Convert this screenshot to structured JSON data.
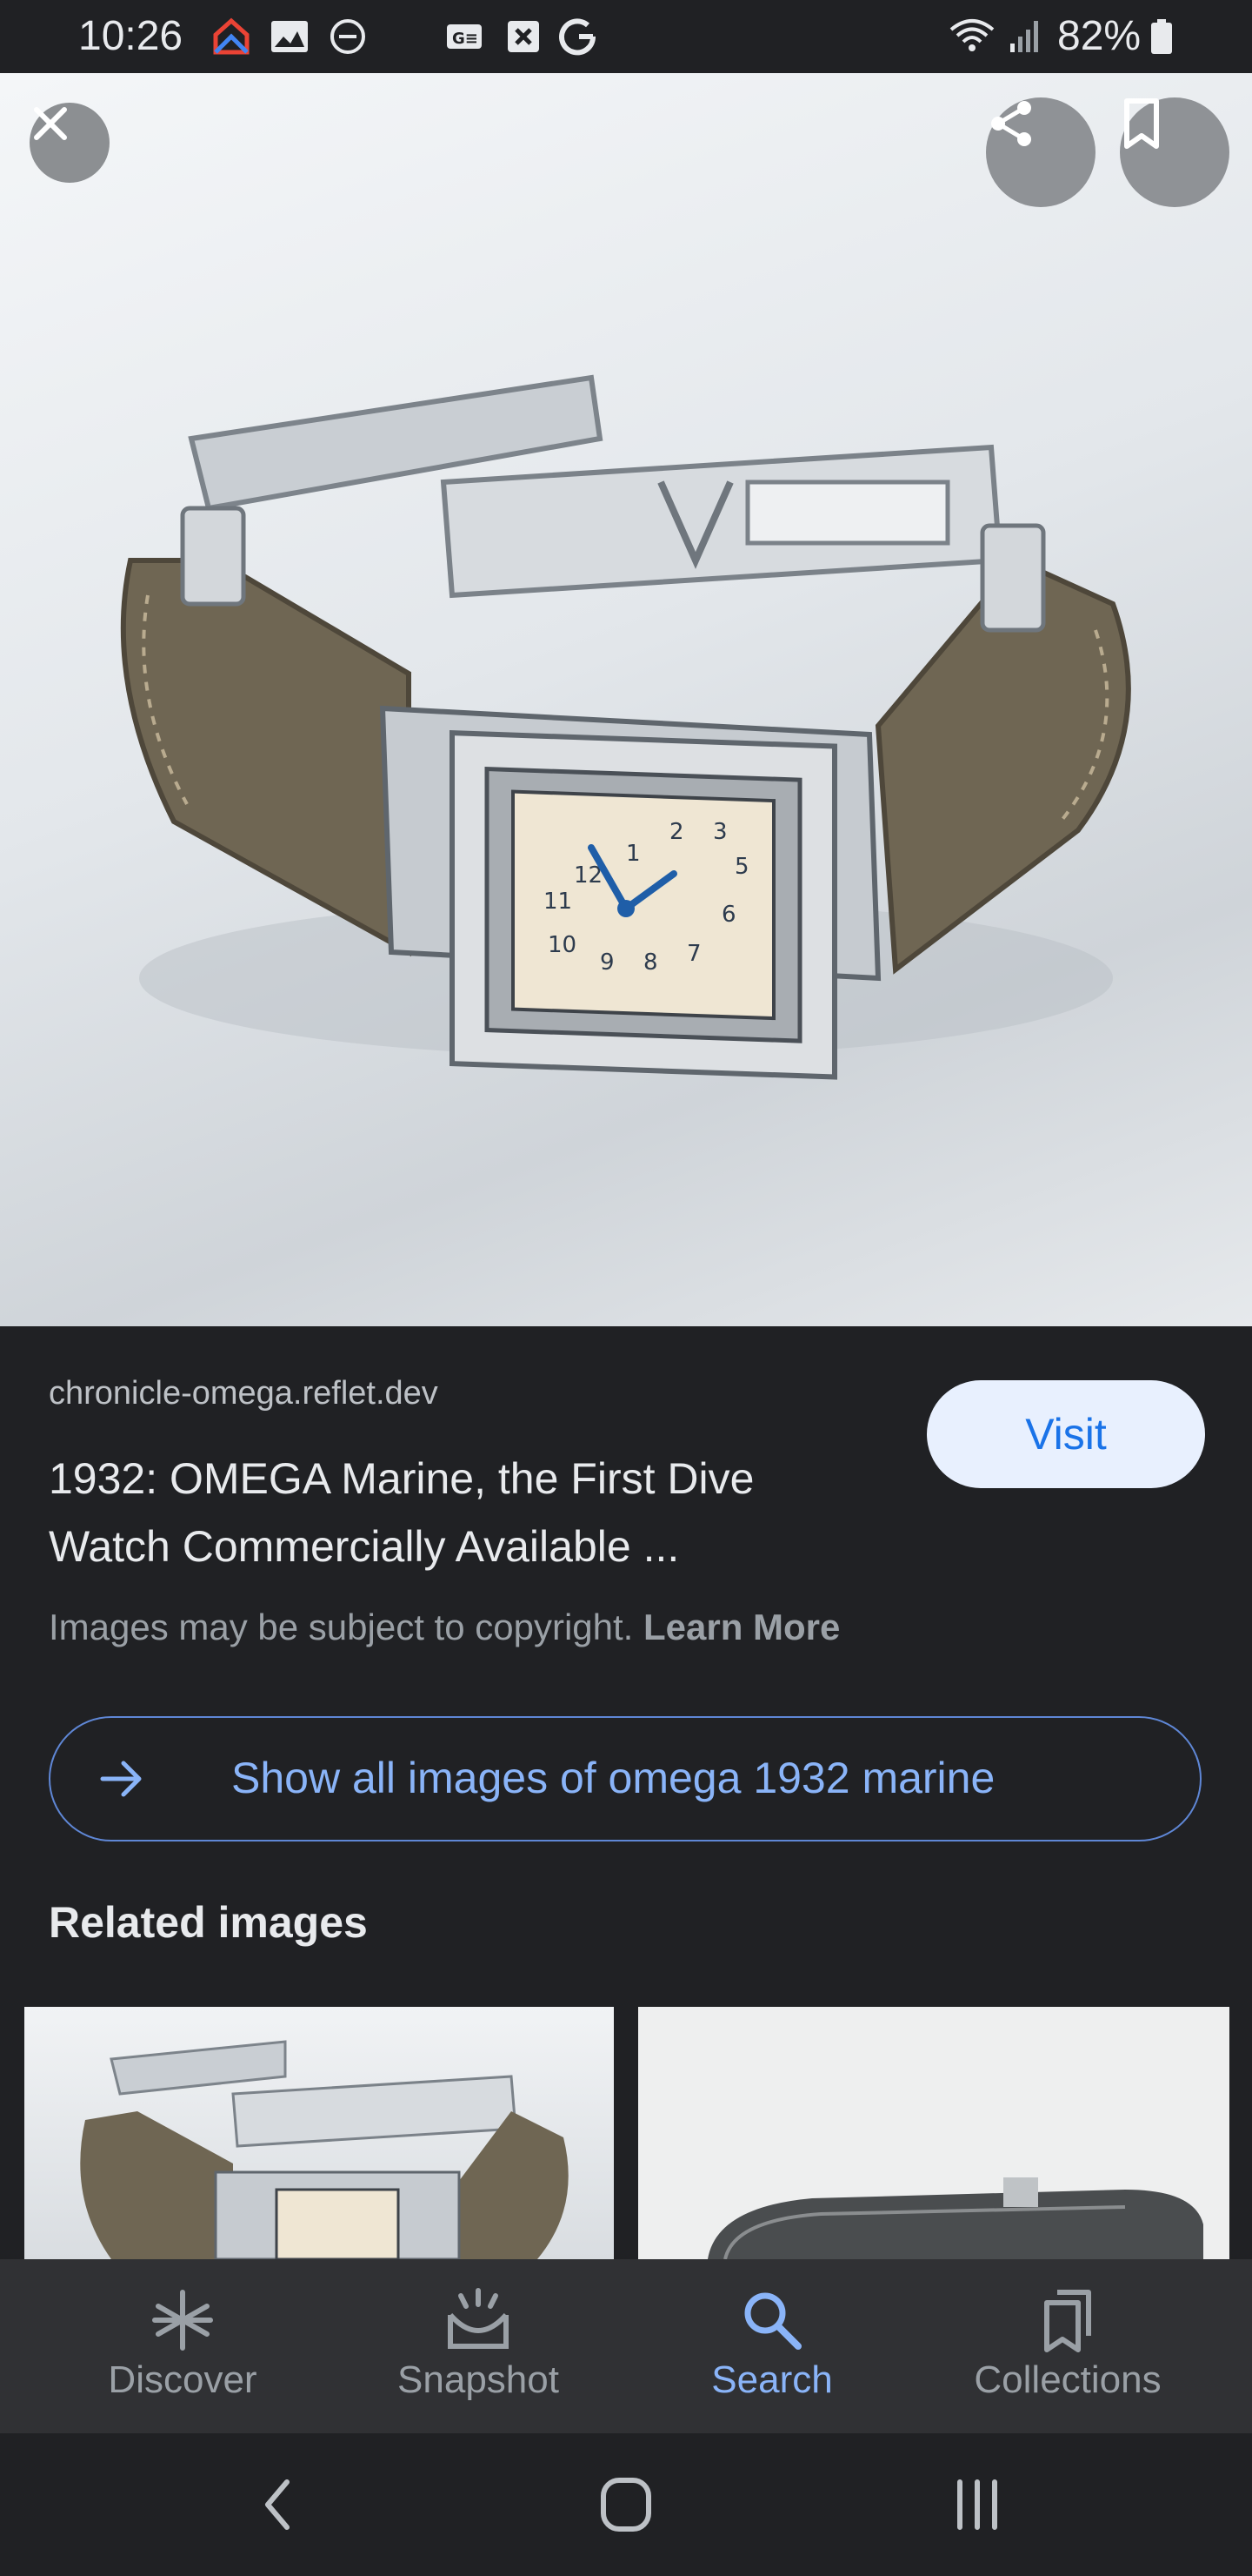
{
  "status_bar": {
    "time": "10:26",
    "battery": "82%",
    "icons": [
      "google-home-icon",
      "gallery-icon",
      "do-not-disturb-icon",
      "news-icon",
      "close-box-icon",
      "google-icon",
      "wifi-icon",
      "signal-icon",
      "battery-icon"
    ]
  },
  "hero": {
    "alt": "Omega Marine 1932 wristwatch on leather strap",
    "close_icon": "close-icon",
    "share_icon": "share-icon",
    "save_icon": "bookmark-icon"
  },
  "result": {
    "source": "chronicle-omega.reflet.dev",
    "title": "1932: OMEGA Marine, the First Dive Watch Commercially Available ...",
    "visit_label": "Visit",
    "copyright_text": "Images may be subject to copyright. ",
    "learn_more": "Learn More",
    "show_all_label": "Show all images of omega 1932 marine"
  },
  "related": {
    "heading": "Related images"
  },
  "bottom_nav": {
    "items": [
      {
        "label": "Discover",
        "icon": "asterisk-icon"
      },
      {
        "label": "Snapshot",
        "icon": "snapshot-icon"
      },
      {
        "label": "Search",
        "icon": "search-icon",
        "active": true
      },
      {
        "label": "Collections",
        "icon": "collections-icon"
      }
    ]
  },
  "colors": {
    "background": "#202124",
    "accent": "#8ab4f8",
    "visit_bg": "#e8f0fe",
    "visit_text": "#1a73e8"
  }
}
